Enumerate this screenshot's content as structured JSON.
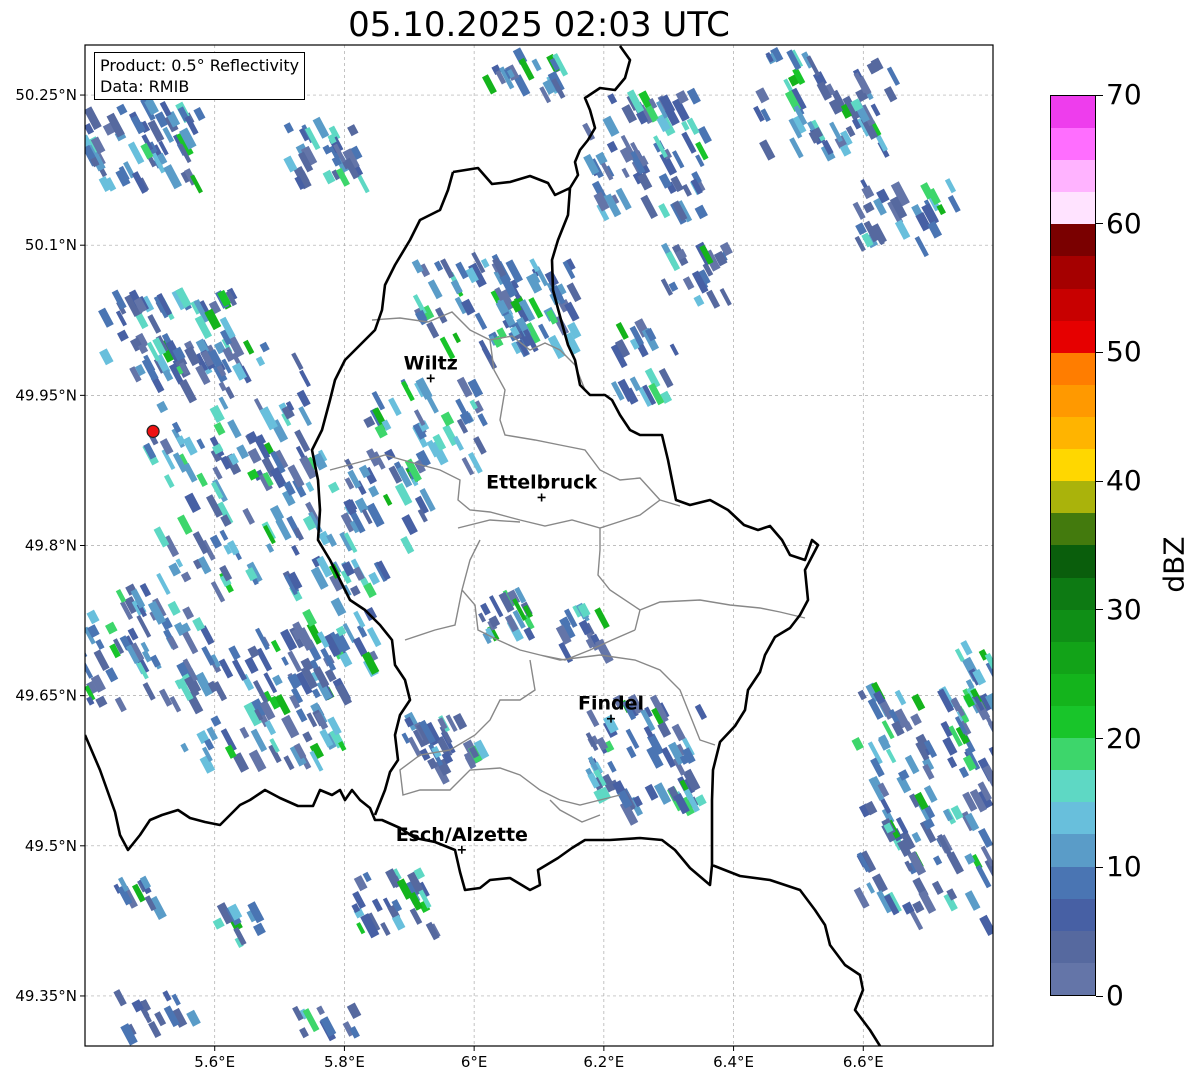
{
  "title": "05.10.2025 02:03 UTC",
  "info": {
    "product": "Product: 0.5° Reflectivity",
    "source": "Data: RMIB"
  },
  "map": {
    "lon_range": [
      5.4,
      6.8
    ],
    "lat_range": [
      49.3,
      50.3
    ],
    "lon_ticks": [
      {
        "value": 5.6,
        "label": "5.6°E"
      },
      {
        "value": 5.8,
        "label": "5.8°E"
      },
      {
        "value": 6.0,
        "label": "6°E"
      },
      {
        "value": 6.2,
        "label": "6.2°E"
      },
      {
        "value": 6.4,
        "label": "6.4°E"
      },
      {
        "value": 6.6,
        "label": "6.6°E"
      }
    ],
    "lat_ticks": [
      {
        "value": 49.35,
        "label": "49.35°N"
      },
      {
        "value": 49.5,
        "label": "49.5°N"
      },
      {
        "value": 49.65,
        "label": "49.65°N"
      },
      {
        "value": 49.8,
        "label": "49.8°N"
      },
      {
        "value": 49.95,
        "label": "49.95°N"
      },
      {
        "value": 50.1,
        "label": "50.1°N"
      },
      {
        "value": 50.25,
        "label": "50.25°N"
      }
    ],
    "cities": [
      {
        "name": "Wiltz",
        "lon": 5.933,
        "lat": 49.967
      },
      {
        "name": "Ettelbruck",
        "lon": 6.104,
        "lat": 49.848
      },
      {
        "name": "Findel",
        "lon": 6.211,
        "lat": 49.627
      },
      {
        "name": "Esch/Alzette",
        "lon": 5.981,
        "lat": 49.496
      }
    ],
    "radar_site": {
      "lon": 5.505,
      "lat": 49.914,
      "color": "#ee1111"
    }
  },
  "colorbar": {
    "label": "dBZ",
    "min": 0,
    "max": 70,
    "ticks": [
      {
        "value": 0,
        "label": "0"
      },
      {
        "value": 10,
        "label": "10"
      },
      {
        "value": 20,
        "label": "20"
      },
      {
        "value": 30,
        "label": "30"
      },
      {
        "value": 40,
        "label": "40"
      },
      {
        "value": 50,
        "label": "50"
      },
      {
        "value": 60,
        "label": "60"
      },
      {
        "value": 70,
        "label": "70"
      }
    ],
    "colors": [
      "#6475a8",
      "#56699f",
      "#4760a4",
      "#4a75b3",
      "#5a9cc8",
      "#68bfdc",
      "#5ed8c4",
      "#3dd66b",
      "#18c52a",
      "#14b41c",
      "#12a318",
      "#0f8f16",
      "#0d7a13",
      "#0a5e0c",
      "#437a0d",
      "#aab30b",
      "#ffd700",
      "#ffb400",
      "#ff9900",
      "#ff7d00",
      "#e60000",
      "#c80000",
      "#a50000",
      "#7a0000",
      "#ffe3ff",
      "#ffb3ff",
      "#ff6eff",
      "#ee3ded"
    ]
  }
}
